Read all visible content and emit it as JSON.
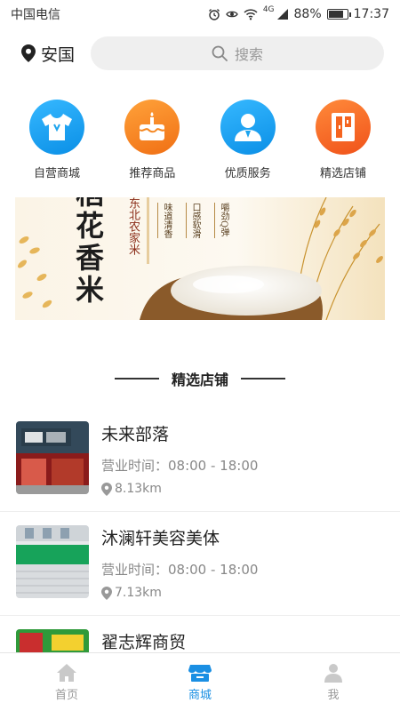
{
  "status_bar": {
    "carrier": "中国电信",
    "network": "4G",
    "battery": "88%",
    "battery_level": 0.88,
    "time": "17:37"
  },
  "header": {
    "location": "安国",
    "search_placeholder": "搜索"
  },
  "categories": [
    {
      "label": "自营商城",
      "icon": "tshirt-icon",
      "color": "#1da4ee"
    },
    {
      "label": "推荐商品",
      "icon": "cake-icon",
      "color": "#f5861f"
    },
    {
      "label": "优质服务",
      "icon": "person-icon",
      "color": "#1da4ee"
    },
    {
      "label": "精选店铺",
      "icon": "storefront-icon",
      "color": "#f5641f"
    }
  ],
  "banner": {
    "title_chars": [
      "稻",
      "花",
      "香",
      "米"
    ],
    "subtitle": "东北农家米",
    "features": [
      "味道清香",
      "口感软滑",
      "嚼劲Q弹"
    ]
  },
  "section": {
    "title": "精选店铺"
  },
  "stores": [
    {
      "name": "未来部落",
      "hours": "营业时间：08:00 - 18:00",
      "distance": "8.13km"
    },
    {
      "name": "沐澜轩美容美体",
      "hours": "营业时间：08:00 - 18:00",
      "distance": "7.13km"
    },
    {
      "name": "翟志辉商贸",
      "hours": "",
      "distance": ""
    }
  ],
  "nav": {
    "items": [
      {
        "label": "首页",
        "icon": "home-icon"
      },
      {
        "label": "商城",
        "icon": "shop-icon"
      },
      {
        "label": "我",
        "icon": "user-icon"
      }
    ],
    "active_color": "#1a8fe3",
    "inactive_color": "#999999"
  }
}
